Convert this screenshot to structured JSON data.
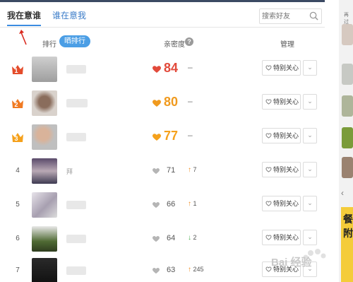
{
  "tabs": [
    {
      "label": "我在意谁",
      "active": true
    },
    {
      "label": "谁在意我",
      "active": false
    }
  ],
  "search": {
    "placeholder": "搜索好友"
  },
  "header": {
    "rank_label": "排行",
    "share_rank_label": "晒排行",
    "intimacy_label": "亲密度",
    "help_label": "?",
    "manage_label": "管理"
  },
  "rows": [
    {
      "rank": "1",
      "score": "84",
      "change": "–",
      "direction": "none",
      "name": ""
    },
    {
      "rank": "2",
      "score": "80",
      "change": "–",
      "direction": "none",
      "name": ""
    },
    {
      "rank": "3",
      "score": "77",
      "change": "–",
      "direction": "none",
      "name": ""
    },
    {
      "rank": "4",
      "score": "71",
      "change": "7",
      "direction": "up",
      "name": "拜"
    },
    {
      "rank": "5",
      "score": "66",
      "change": "1",
      "direction": "up",
      "name": ""
    },
    {
      "rank": "6",
      "score": "64",
      "change": "2",
      "direction": "down",
      "name": ""
    },
    {
      "rank": "7",
      "score": "63",
      "change": "245",
      "direction": "up",
      "name": ""
    }
  ],
  "care_button_label": "特别关心",
  "more_button_label": "⌄",
  "side_panel": {
    "ad_text": "餐",
    "ad_text_2": "附",
    "top_text": "再过"
  },
  "watermark": "Bai 经验",
  "colors": {
    "accent": "#3b8ce0",
    "rank_red": "#e44c2b",
    "rank_orange": "#f5a11c",
    "score_red": "#e24a3b",
    "score_orange": "#f09a1e"
  }
}
